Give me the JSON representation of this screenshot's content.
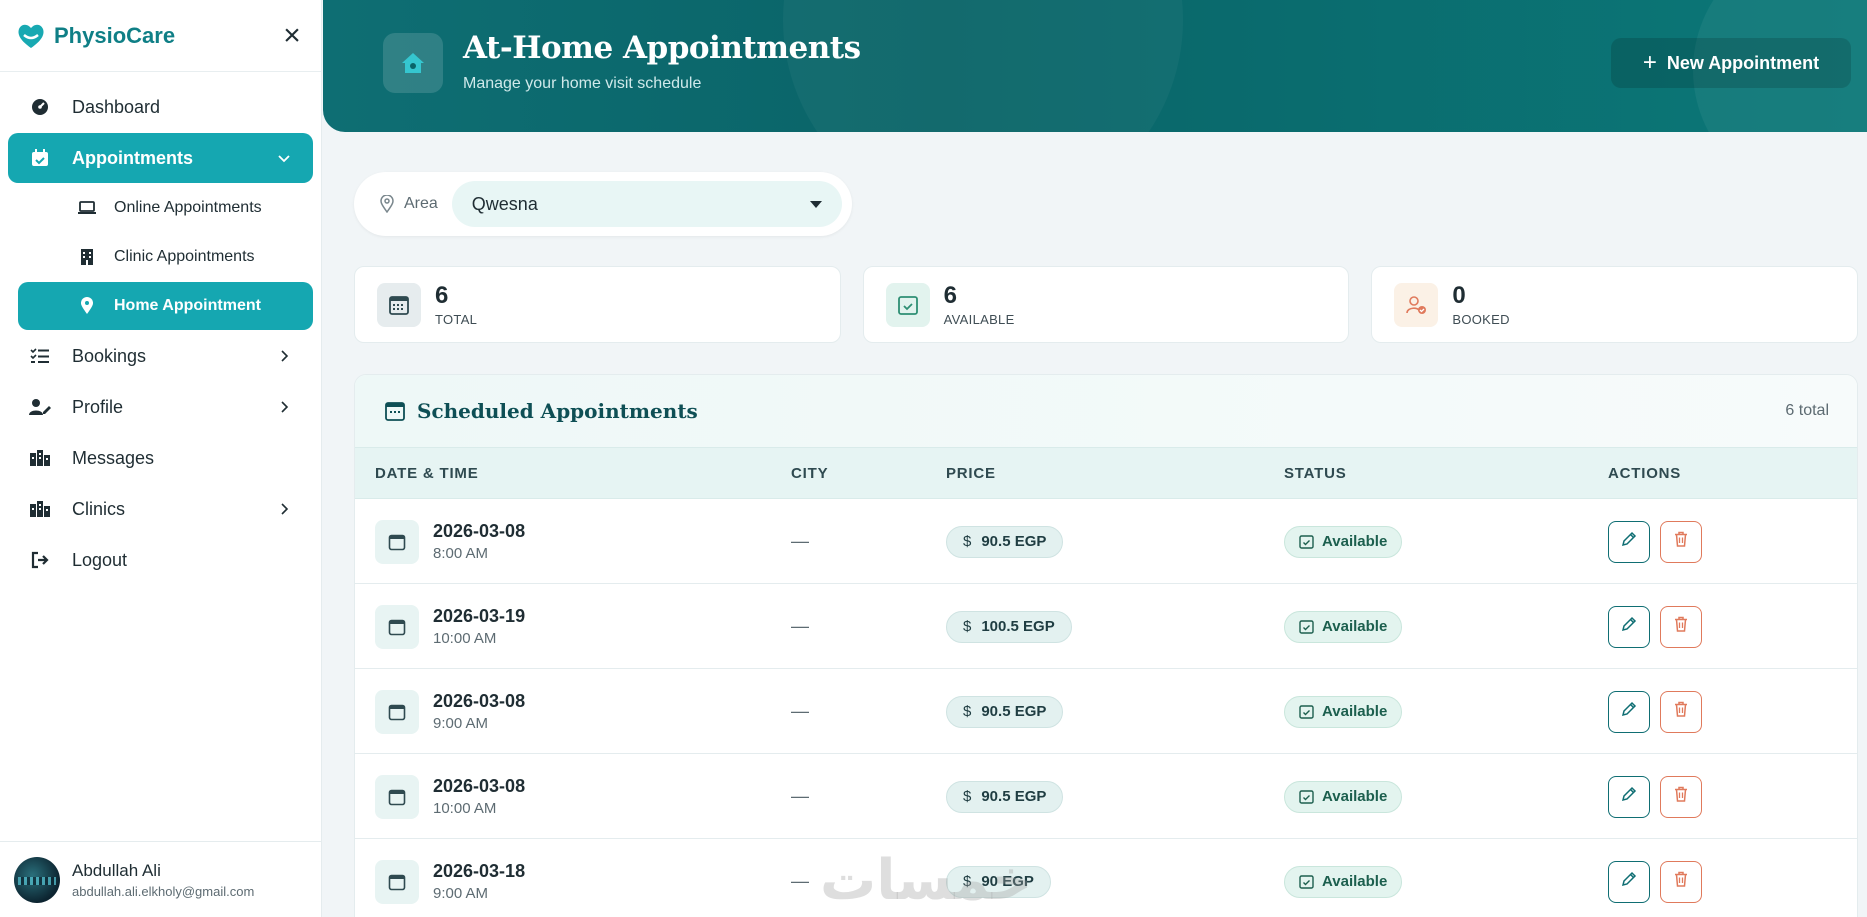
{
  "brand": {
    "name": "PhysioCare"
  },
  "sidebar": {
    "items": [
      {
        "label": "Dashboard"
      },
      {
        "label": "Appointments"
      },
      {
        "label": "Bookings"
      },
      {
        "label": "Profile"
      },
      {
        "label": "Messages"
      },
      {
        "label": "Clinics"
      },
      {
        "label": "Logout"
      }
    ],
    "sub_items": [
      {
        "label": "Online Appointments"
      },
      {
        "label": "Clinic Appointments"
      },
      {
        "label": "Home Appointment"
      }
    ]
  },
  "user": {
    "name": "Abdullah Ali",
    "email": "abdullah.ali.elkholy@gmail.com"
  },
  "header": {
    "title": "At-Home Appointments",
    "subtitle": "Manage your home visit schedule",
    "new_button": "New Appointment"
  },
  "filter": {
    "label": "Area",
    "selected": "Qwesna"
  },
  "stats": [
    {
      "value": "6",
      "label": "TOTAL"
    },
    {
      "value": "6",
      "label": "AVAILABLE"
    },
    {
      "value": "0",
      "label": "BOOKED"
    }
  ],
  "table": {
    "title": "Scheduled Appointments",
    "total": "6 total",
    "columns": [
      "DATE & TIME",
      "CITY",
      "PRICE",
      "STATUS",
      "ACTIONS"
    ],
    "currency_symbol": "$",
    "rows": [
      {
        "date": "2026-03-08",
        "time": "8:00 AM",
        "city": "—",
        "price": "90.5 EGP",
        "status": "Available"
      },
      {
        "date": "2026-03-19",
        "time": "10:00 AM",
        "city": "—",
        "price": "100.5 EGP",
        "status": "Available"
      },
      {
        "date": "2026-03-08",
        "time": "9:00 AM",
        "city": "—",
        "price": "90.5 EGP",
        "status": "Available"
      },
      {
        "date": "2026-03-08",
        "time": "10:00 AM",
        "city": "—",
        "price": "90.5 EGP",
        "status": "Available"
      },
      {
        "date": "2026-03-18",
        "time": "9:00 AM",
        "city": "—",
        "price": "90 EGP",
        "status": "Available"
      }
    ]
  },
  "watermark": "خمسات",
  "colors": {
    "accent": "#15a7b1",
    "header": "#0a6468",
    "danger": "#e07a5c"
  }
}
